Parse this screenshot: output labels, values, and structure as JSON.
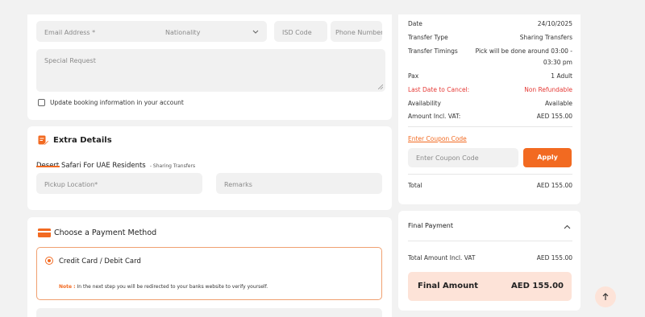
{
  "guest_form": {
    "email_placeholder": "Email Address *",
    "nationality_placeholder": "Nationality",
    "isd_placeholder": "ISD Code",
    "phone_placeholder": "Phone Number",
    "special_request_placeholder": "Special Request",
    "update_booking_label": "Update booking information in your account"
  },
  "extra_details": {
    "heading": "Extra Details",
    "tour_title": "Desert Safari For UAE Residents",
    "tour_subtitle": "- Sharing Transfers",
    "pickup_placeholder": "Pickup Location*",
    "remarks_placeholder": "Remarks"
  },
  "payment": {
    "heading": "Choose a Payment Method",
    "option_label": "Credit Card / Debit Card",
    "note_label": "Note :",
    "note_text": "In the next step you will be redirected to your banks website to verify yourself."
  },
  "summary": {
    "rows": [
      {
        "label": "Date",
        "value": "24/10/2025"
      },
      {
        "label": "Transfer Type",
        "value": "Sharing Transfers"
      },
      {
        "label": "Transfer Timings",
        "value_line1": "Pick will be done around 03:00 -",
        "value_line2": "03:30 pm"
      },
      {
        "label": "Pax",
        "value": "1 Adult"
      },
      {
        "label": "Last Date to Cancel:",
        "value": "Non Refundable"
      },
      {
        "label": "Availability",
        "value": "Available"
      },
      {
        "label": "Amount Incl. VAT:",
        "value": "AED 155.00"
      }
    ],
    "coupon_link": "Enter Coupon Code",
    "coupon_placeholder": "Enter Coupon Code",
    "apply_label": "Apply",
    "total_label": "Total",
    "total_value": "AED 155.00"
  },
  "final_payment": {
    "heading": "Final Payment",
    "total_label": "Total Amount Incl. VAT",
    "total_value": "AED 155.00",
    "final_label": "Final Amount",
    "final_value": "AED 155.00"
  },
  "colors": {
    "accent": "#f26a21",
    "danger": "#e53935",
    "highlight_bg": "#fde3d8"
  },
  "icons": {
    "nationality_dropdown": "chevron-down-icon",
    "extra_details": "edit-note-icon",
    "payment": "credit-card-icon",
    "final_payment_toggle": "chevron-up-icon",
    "scroll_top": "arrow-up-icon"
  }
}
